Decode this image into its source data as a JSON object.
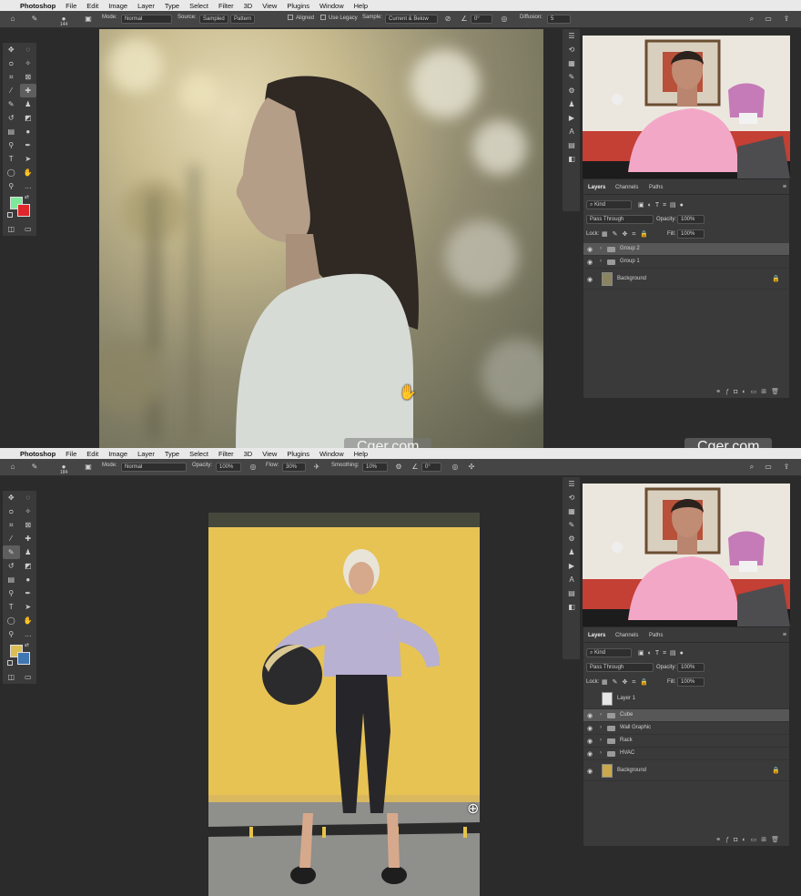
{
  "shot1": {
    "menubar": {
      "apple": "",
      "items": [
        "Photoshop",
        "File",
        "Edit",
        "Image",
        "Layer",
        "Type",
        "Select",
        "Filter",
        "3D",
        "View",
        "Plugins",
        "Window",
        "Help"
      ]
    },
    "options": {
      "brush_size": "144",
      "mode_label": "Mode:",
      "mode_value": "Normal",
      "source_label": "Source:",
      "source_sampled": "Sampled",
      "source_pattern": "Pattern",
      "aligned": "Aligned",
      "use_legacy": "Use Legacy",
      "sample_label": "Sample:",
      "sample_value": "Current & Below",
      "angle_value": "0°",
      "diffusion_label": "Diffusion:",
      "diffusion_value": "5"
    },
    "tools": {
      "fg_color": "#7de89a",
      "bg_color": "#e0262b"
    },
    "layers_panel": {
      "tabs": [
        "Layers",
        "Channels",
        "Paths"
      ],
      "kind": "Kind",
      "blend": "Pass Through",
      "opacity_label": "Opacity:",
      "opacity_value": "100%",
      "lock_label": "Lock:",
      "fill_label": "Fill:",
      "fill_value": "100%",
      "layers": [
        {
          "name": "Group 2",
          "selected": true
        },
        {
          "name": "Group 1",
          "selected": false
        }
      ],
      "background": "Background"
    },
    "watermark_left": "Cger.com",
    "watermark_right": "Cger.com"
  },
  "shot2": {
    "menubar": {
      "apple": "",
      "items": [
        "Photoshop",
        "File",
        "Edit",
        "Image",
        "Layer",
        "Type",
        "Select",
        "Filter",
        "3D",
        "View",
        "Plugins",
        "Window",
        "Help"
      ]
    },
    "options": {
      "brush_size": "184",
      "mode_label": "Mode:",
      "mode_value": "Normal",
      "opacity_label": "Opacity:",
      "opacity_value": "100%",
      "flow_label": "Flow:",
      "flow_value": "30%",
      "smoothing_label": "Smoothing:",
      "smoothing_value": "10%",
      "angle_value": "0°"
    },
    "tools": {
      "fg_color": "#dcbd54",
      "bg_color": "#3f77b3"
    },
    "layers_panel": {
      "tabs": [
        "Layers",
        "Channels",
        "Paths"
      ],
      "kind": "Kind",
      "blend": "Pass Through",
      "opacity_label": "Opacity:",
      "opacity_value": "100%",
      "lock_label": "Lock:",
      "fill_label": "Fill:",
      "fill_value": "100%",
      "layer1": "Layer 1",
      "groups": [
        {
          "name": "Cube",
          "selected": true
        },
        {
          "name": "Wall Graphic",
          "selected": false
        },
        {
          "name": "Rack",
          "selected": false
        },
        {
          "name": "HVAC",
          "selected": false
        }
      ],
      "background": "Background"
    }
  }
}
